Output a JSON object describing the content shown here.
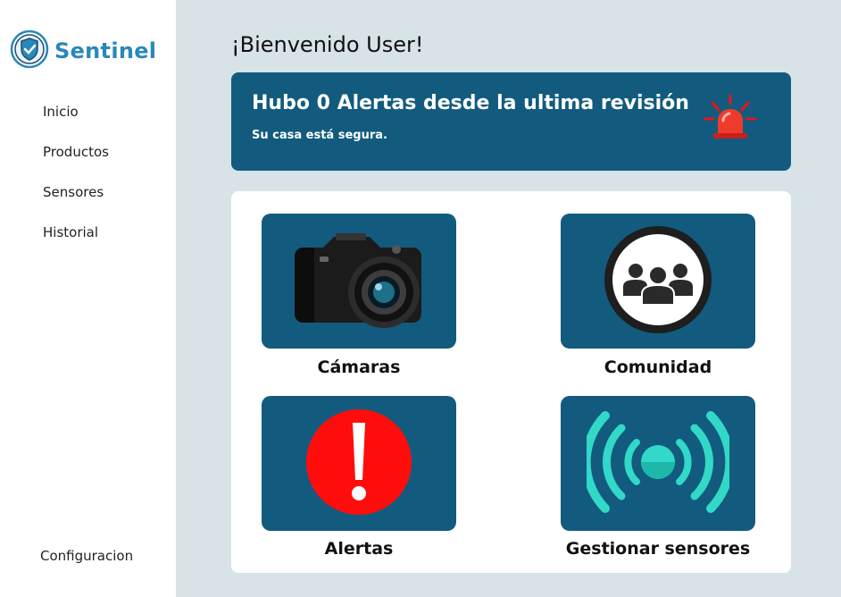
{
  "app": {
    "name": "Sentinel"
  },
  "sidebar": {
    "items": [
      {
        "label": "Inicio"
      },
      {
        "label": "Productos"
      },
      {
        "label": "Sensores"
      },
      {
        "label": "Historial"
      }
    ],
    "settings_label": "Configuracion"
  },
  "header": {
    "welcome": "¡Bienvenido User!"
  },
  "alert_banner": {
    "title": "Hubo 0 Alertas desde la ultima revisión",
    "subtitle": "Su casa está segura.",
    "icon": "siren-icon"
  },
  "tiles": [
    {
      "label": "Cámaras",
      "icon": "camera-icon"
    },
    {
      "label": "Comunidad",
      "icon": "community-icon"
    },
    {
      "label": "Alertas",
      "icon": "alert-icon"
    },
    {
      "label": "Gestionar sensores",
      "icon": "sensor-signal-icon"
    }
  ],
  "colors": {
    "brand": "#2a88b8",
    "card_bg": "#125b7e",
    "page_bg": "#d8e3e8",
    "alert_red": "#e8141a",
    "sensor_teal": "#32d8c8"
  }
}
